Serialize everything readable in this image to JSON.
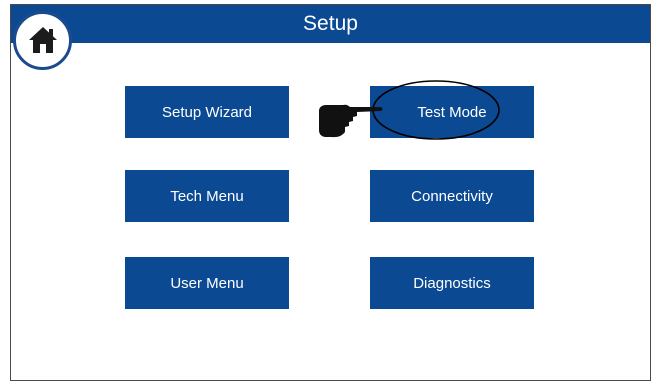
{
  "header": {
    "title": "Setup",
    "home_icon": "home-icon",
    "color": "#0b4a93"
  },
  "buttons": {
    "setup_wizard": "Setup Wizard",
    "test_mode": "Test Mode",
    "tech_menu": "Tech Menu",
    "connectivity": "Connectivity",
    "user_menu": "User Menu",
    "diagnostics": "Diagnostics"
  },
  "annotations": {
    "pointer_icon": "pointing-hand-icon",
    "highlight_shape": "ellipse-outline"
  },
  "colors": {
    "button_bg": "#0b4a93",
    "button_text": "#ffffff",
    "page_bg": "#ffffff"
  }
}
